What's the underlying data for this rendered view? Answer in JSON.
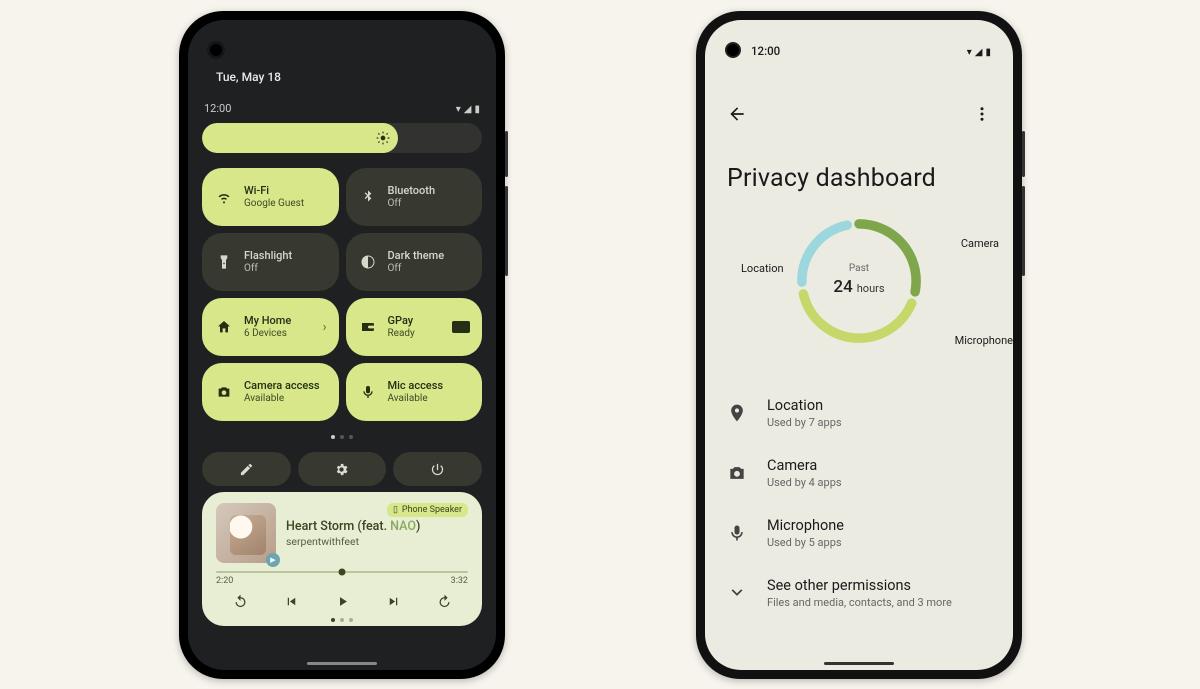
{
  "left": {
    "date": "Tue, May 18",
    "time": "12:00",
    "brightness_percent": 70,
    "tiles": [
      {
        "icon": "wifi",
        "title": "Wi-Fi",
        "sub": "Google Guest",
        "on": true,
        "chevron": false
      },
      {
        "icon": "bluetooth",
        "title": "Bluetooth",
        "sub": "Off",
        "on": false,
        "chevron": false
      },
      {
        "icon": "flashlight",
        "title": "Flashlight",
        "sub": "Off",
        "on": false,
        "chevron": false
      },
      {
        "icon": "darktheme",
        "title": "Dark theme",
        "sub": "Off",
        "on": false,
        "chevron": false
      },
      {
        "icon": "home",
        "title": "My Home",
        "sub": "6 Devices",
        "on": true,
        "chevron": true
      },
      {
        "icon": "wallet",
        "title": "GPay",
        "sub": "Ready",
        "on": true,
        "card": true
      },
      {
        "icon": "camera",
        "title": "Camera access",
        "sub": "Available",
        "on": true
      },
      {
        "icon": "mic",
        "title": "Mic access",
        "sub": "Available",
        "on": true
      }
    ],
    "media": {
      "output": "Phone Speaker",
      "title_main": "Heart Storm (feat. ",
      "title_feat": "NAO",
      "title_close": ")",
      "artist": "serpentwithfeet",
      "elapsed": "2:20",
      "duration": "3:32",
      "progress_percent": 50
    }
  },
  "right": {
    "time": "12:00",
    "title": "Privacy dashboard",
    "donut": {
      "center_top": "Past",
      "center_num": "24",
      "center_unit": "hours",
      "labels": {
        "location": "Location",
        "camera": "Camera",
        "mic": "Microphone"
      },
      "segments": [
        {
          "name": "camera",
          "fraction": 0.28,
          "color": "#7fa64a"
        },
        {
          "name": "mic",
          "fraction": 0.4,
          "color": "#c6d86a"
        },
        {
          "name": "location",
          "fraction": 0.22,
          "color": "#9cd7de"
        }
      ],
      "gap_fraction": 0.033
    },
    "list": [
      {
        "icon": "location",
        "title": "Location",
        "sub": "Used by 7 apps"
      },
      {
        "icon": "camera",
        "title": "Camera",
        "sub": "Used by 4 apps"
      },
      {
        "icon": "mic",
        "title": "Microphone",
        "sub": "Used by 5 apps"
      },
      {
        "icon": "expand",
        "title": "See other permissions",
        "sub": "Files and media, contacts, and 3 more"
      }
    ]
  }
}
